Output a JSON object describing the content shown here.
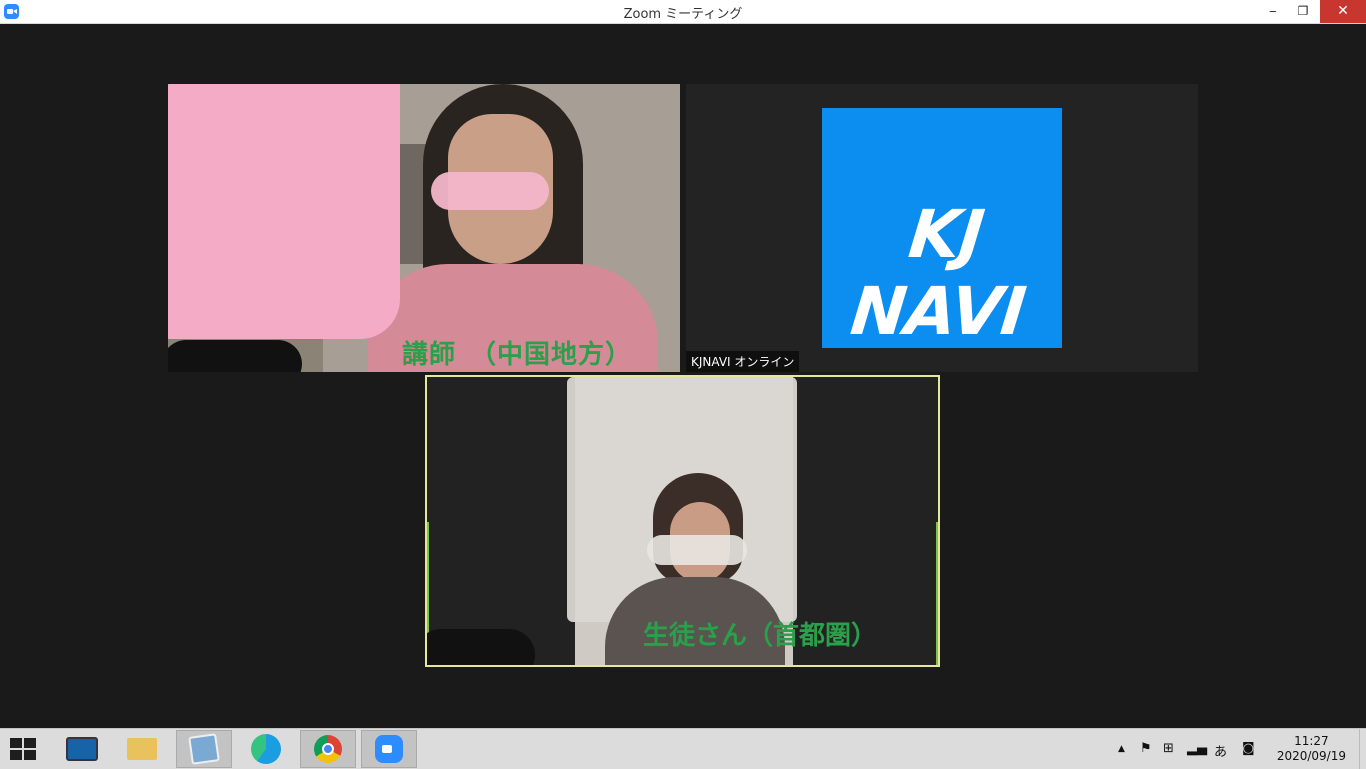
{
  "window": {
    "title": "Zoom ミーティング",
    "minimize": "‒",
    "maximize": "❐",
    "close": "✕"
  },
  "tiles": {
    "teacher": {
      "caption": "講師　（中国地方）"
    },
    "kjnavi": {
      "logo_text": "KJ NAVI",
      "name_label": "KJNAVI オンライン",
      "logo_color": "#0b8ef0"
    },
    "student": {
      "caption": "生徒さん（首都圏）",
      "active_border": "#e7e79a"
    }
  },
  "taskbar": {
    "apps": [
      {
        "name": "lenovo-app",
        "icon": "lenovo-icon"
      },
      {
        "name": "file-explorer",
        "icon": "folder-icon"
      },
      {
        "name": "photos",
        "icon": "photos-icon"
      },
      {
        "name": "edge",
        "icon": "edge-icon"
      },
      {
        "name": "chrome",
        "icon": "chrome-icon"
      },
      {
        "name": "zoom",
        "icon": "zoom-icon"
      }
    ],
    "tray": {
      "overflow": "▲",
      "ime": "あ"
    },
    "clock": {
      "time": "11:27",
      "date": "2020/09/19"
    }
  }
}
